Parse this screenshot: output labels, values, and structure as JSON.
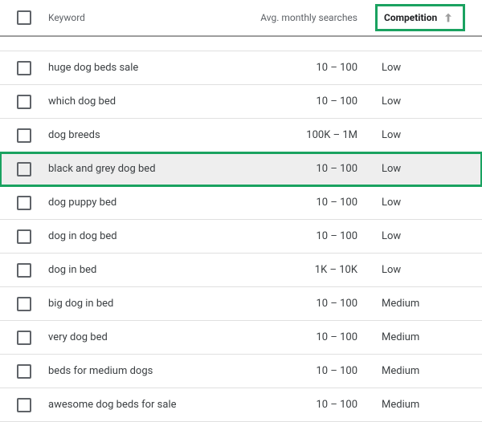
{
  "header": {
    "keyword": "Keyword",
    "searches": "Avg. monthly searches",
    "competition": "Competition",
    "sort_direction": "asc"
  },
  "rows": [
    {
      "keyword": "huge dog beds sale",
      "searches": "10 – 100",
      "competition": "Low",
      "selected": false,
      "highlight": false
    },
    {
      "keyword": "which dog bed",
      "searches": "10 – 100",
      "competition": "Low",
      "selected": false,
      "highlight": false
    },
    {
      "keyword": "dog breeds",
      "searches": "100K – 1M",
      "competition": "Low",
      "selected": false,
      "highlight": false
    },
    {
      "keyword": "black and grey dog bed",
      "searches": "10 – 100",
      "competition": "Low",
      "selected": false,
      "highlight": true
    },
    {
      "keyword": "dog puppy bed",
      "searches": "10 – 100",
      "competition": "Low",
      "selected": false,
      "highlight": false
    },
    {
      "keyword": "dog in dog bed",
      "searches": "10 – 100",
      "competition": "Low",
      "selected": false,
      "highlight": false
    },
    {
      "keyword": "dog in bed",
      "searches": "1K – 10K",
      "competition": "Low",
      "selected": false,
      "highlight": false
    },
    {
      "keyword": "big dog in bed",
      "searches": "10 – 100",
      "competition": "Medium",
      "selected": false,
      "highlight": false
    },
    {
      "keyword": "very dog bed",
      "searches": "10 – 100",
      "competition": "Medium",
      "selected": false,
      "highlight": false
    },
    {
      "keyword": "beds for medium dogs",
      "searches": "10 – 100",
      "competition": "Medium",
      "selected": false,
      "highlight": false
    },
    {
      "keyword": "awesome dog beds for sale",
      "searches": "10 – 100",
      "competition": "Medium",
      "selected": false,
      "highlight": false
    }
  ]
}
